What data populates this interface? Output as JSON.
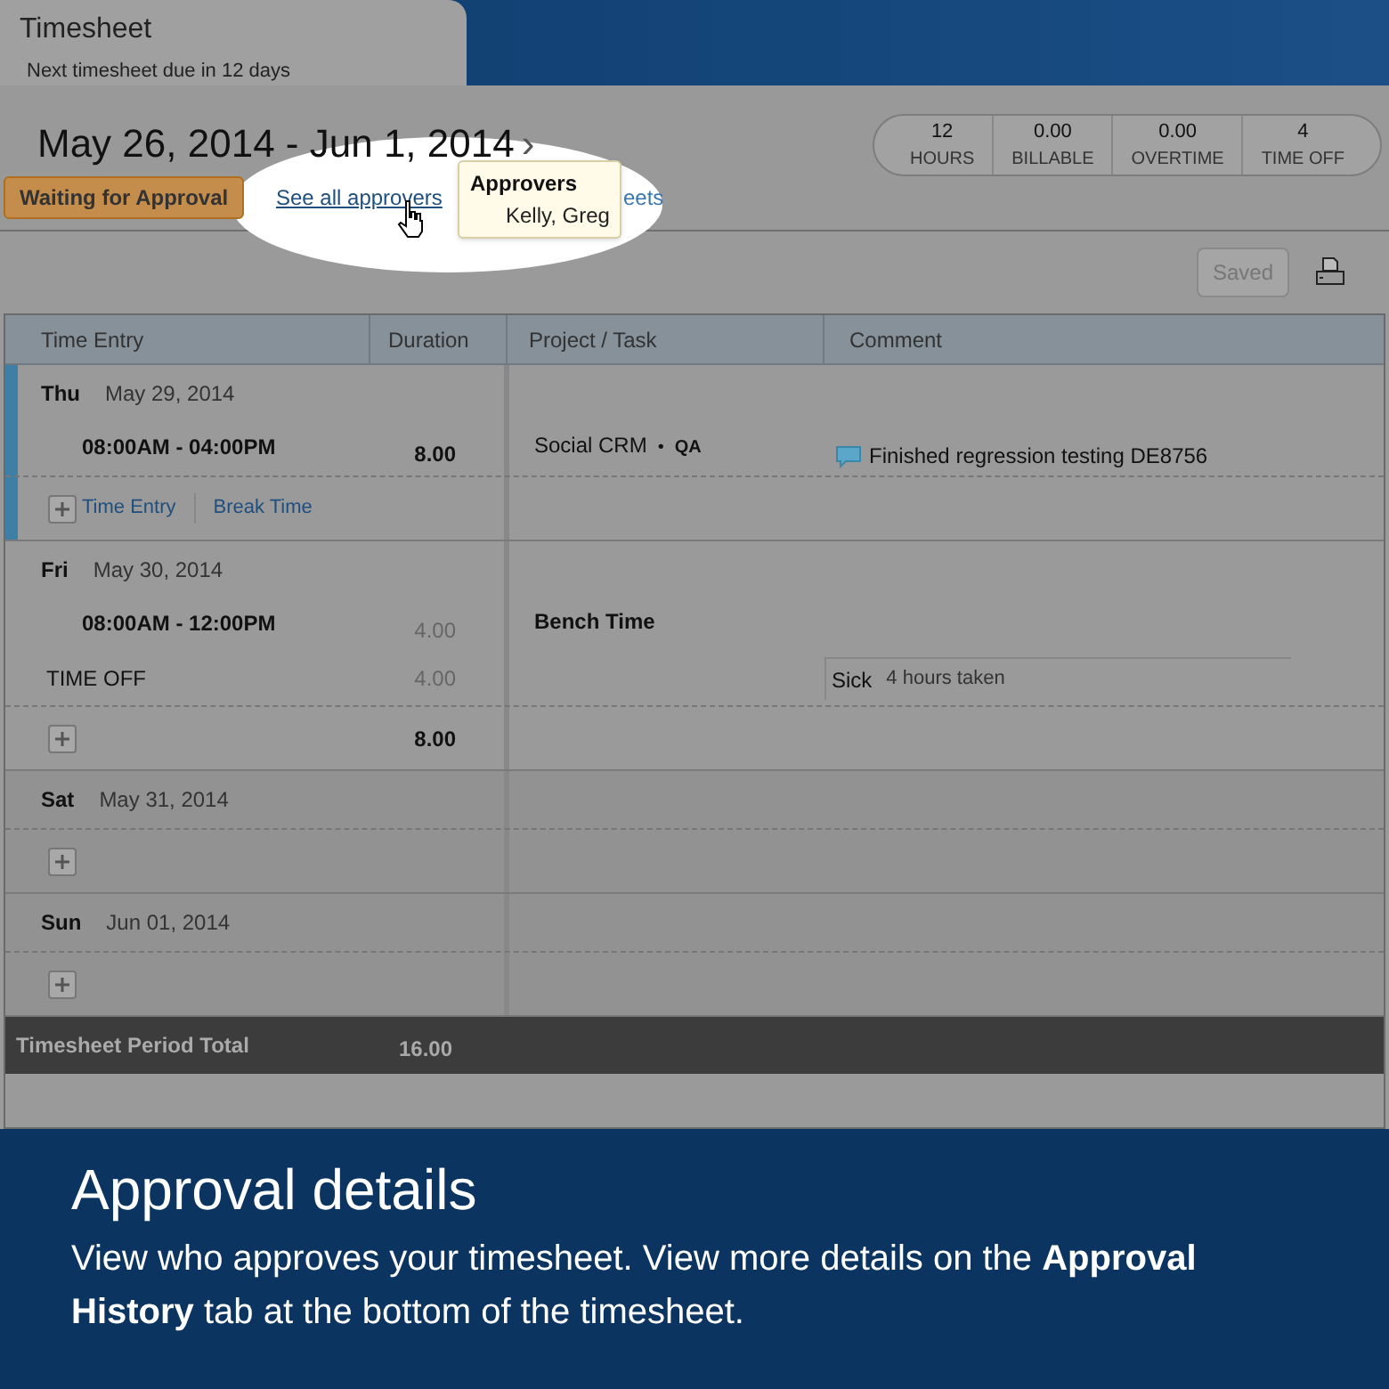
{
  "tab": {
    "title": "Timesheet",
    "subtitle": "Next timesheet due in 12 days"
  },
  "period": {
    "title": "May 26, 2014 - Jun 1, 2014",
    "next": "›"
  },
  "status": "Waiting for Approval",
  "approvers_link": "See all approvers",
  "hidden_link_tail": "eets",
  "tooltip": {
    "title": "Approvers",
    "names": "Kelly, Greg"
  },
  "summary": [
    {
      "value": "12",
      "label": "HOURS"
    },
    {
      "value": "0.00",
      "label": "BILLABLE"
    },
    {
      "value": "0.00",
      "label": "OVERTIME"
    },
    {
      "value": "4",
      "label": "TIME OFF"
    }
  ],
  "save_button": {
    "label": "Saved",
    "disabled": true
  },
  "table": {
    "columns": [
      "Time Entry",
      "Duration",
      "Project / Task",
      "Comment"
    ],
    "days": [
      {
        "day": "Thu",
        "date": "May 29, 2014",
        "selected": true,
        "entries": [
          {
            "kind": "time",
            "label": "08:00AM - 04:00PM",
            "duration": "8.00",
            "project": "Social CRM",
            "bullet": "•",
            "task": "QA",
            "comment": "Finished regression testing DE8756"
          }
        ],
        "actions": [
          "Time Entry",
          "Break Time"
        ]
      },
      {
        "day": "Fri",
        "date": "May 30, 2014",
        "selected": false,
        "entries": [
          {
            "kind": "time",
            "label": "08:00AM - 12:00PM",
            "duration": "4.00",
            "project": "Bench Time"
          },
          {
            "kind": "time_off",
            "label": "TIME OFF",
            "duration": "4.00",
            "type": "Sick",
            "note": "4 hours taken"
          }
        ],
        "total": "8.00"
      },
      {
        "day": "Sat",
        "date": "May 31, 2014",
        "selected": false
      },
      {
        "day": "Sun",
        "date": "Jun 01, 2014",
        "selected": false
      }
    ],
    "total": {
      "label": "Timesheet Period Total",
      "value": "16.00"
    }
  },
  "banner": {
    "title": "Approval details",
    "text": "View who approves your timesheet. View more details on the **Approval History** tab at the bottom of the timesheet."
  }
}
